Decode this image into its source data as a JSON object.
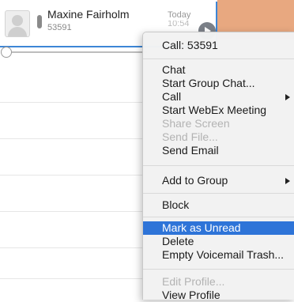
{
  "contact": {
    "name": "Maxine Fairholm",
    "extension": "53591",
    "time": "Today",
    "time_partial": "10:54"
  },
  "menu": {
    "call_header": "Call: 53591",
    "chat": "Chat",
    "start_group_chat": "Start Group Chat...",
    "call": "Call",
    "start_webex": "Start WebEx Meeting",
    "share_screen": "Share Screen",
    "send_file": "Send File...",
    "send_email": "Send Email",
    "add_to_group": "Add to Group",
    "block": "Block",
    "mark_unread": "Mark as Unread",
    "delete": "Delete",
    "empty_trash": "Empty Voicemail Trash...",
    "edit_profile": "Edit Profile...",
    "view_profile": "View Profile"
  },
  "colors": {
    "highlight": "#2e74d8",
    "selection_border": "#3d86d6"
  }
}
